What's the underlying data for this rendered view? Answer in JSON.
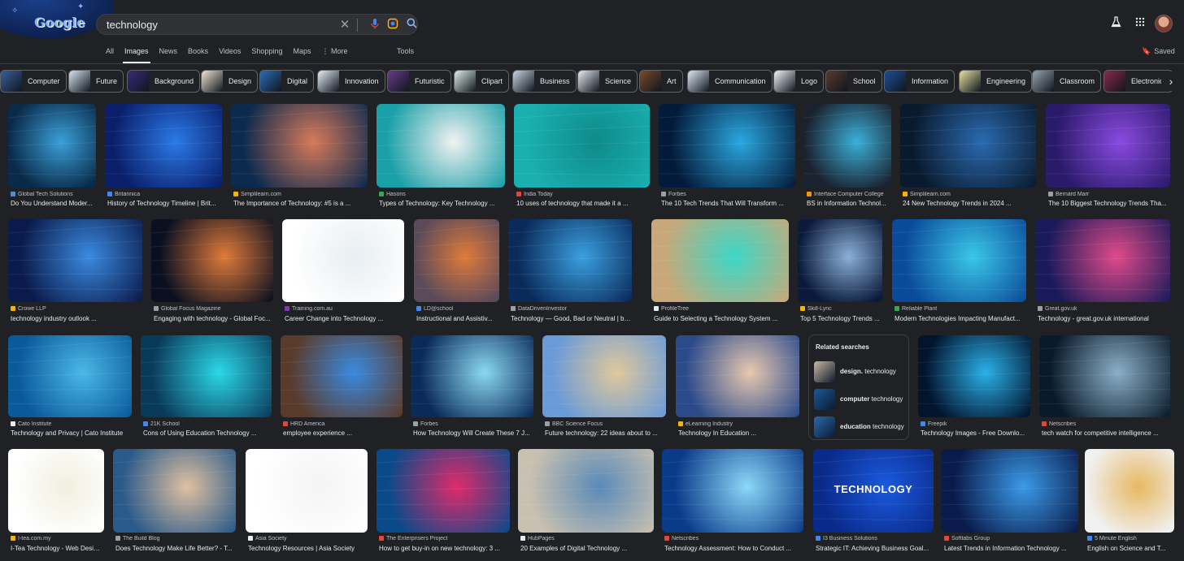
{
  "header": {
    "logo_text": "Google",
    "search_query": "technology",
    "clear_icon": "close-icon",
    "mic_icon": "microphone-icon",
    "lens_icon": "camera-lens-icon",
    "search_icon": "search-icon",
    "labs_icon": "flask-icon",
    "apps_icon": "apps-grid-icon"
  },
  "tabs": [
    "All",
    "Images",
    "News",
    "Books",
    "Videos",
    "Shopping",
    "Maps",
    "More"
  ],
  "active_tab": "Images",
  "tools_label": "Tools",
  "saved_label": "Saved",
  "chips": [
    {
      "label": "Computer",
      "color": "#3a5f9e"
    },
    {
      "label": "Future",
      "color": "#d8e6f2"
    },
    {
      "label": "Background",
      "color": "#3b2a7a"
    },
    {
      "label": "Design",
      "color": "#f0e6d0"
    },
    {
      "label": "Digital",
      "color": "#2a6db8"
    },
    {
      "label": "Innovation",
      "color": "#e8eef6"
    },
    {
      "label": "Futuristic",
      "color": "#6a3a8a"
    },
    {
      "label": "Clipart",
      "color": "#e0efe8"
    },
    {
      "label": "Business",
      "color": "#c9d4e0"
    },
    {
      "label": "Science",
      "color": "#e6ecef"
    },
    {
      "label": "Art",
      "color": "#7a4a2a"
    },
    {
      "label": "Communication",
      "color": "#dfe9f6"
    },
    {
      "label": "Logo",
      "color": "#f2f4f7"
    },
    {
      "label": "School",
      "color": "#5a3a2a"
    },
    {
      "label": "Information",
      "color": "#1f4e96"
    },
    {
      "label": "Engineering",
      "color": "#e8e2a0"
    },
    {
      "label": "Classroom",
      "color": "#9aa4ae"
    },
    {
      "label": "Electronics",
      "color": "#8a2a4a"
    }
  ],
  "results": [
    {
      "source": "Global Tech Solutions",
      "title": "Do You Understand Moder...",
      "fav": "#4a90d9",
      "c1": "#0a2a4a",
      "c2": "#3aa0d8"
    },
    {
      "source": "Britannica",
      "title": "History of Technology Timeline | Brit...",
      "fav": "#4285f4",
      "c1": "#0a1e6a",
      "c2": "#2a7ae8"
    },
    {
      "source": "Simplilearn.com",
      "title": "The Importance of Technology: #5 is a ...",
      "fav": "#f4b400",
      "c1": "#0c2a4e",
      "c2": "#d87a5a"
    },
    {
      "source": "Hasons",
      "title": "Types of Technology: Key Technology ...",
      "fav": "#34a853",
      "c1": "#1aa0a8",
      "c2": "#f2f2f2"
    },
    {
      "source": "India Today",
      "title": "10 uses of technology that made it a ...",
      "fav": "#ea4335",
      "c1": "#1ab0b0",
      "c2": "#0e8a8a"
    },
    {
      "source": "Forbes",
      "title": "The 10 Tech Trends That Will Transform ...",
      "fav": "#9aa0a6",
      "c1": "#041a3a",
      "c2": "#2aa8e0"
    },
    {
      "source": "Interface Computer College",
      "title": "BS in Information Technol...",
      "fav": "#f29900",
      "c1": "#1a2230",
      "c2": "#3ab0d8"
    },
    {
      "source": "Simplilearn.com",
      "title": "24 New Technology Trends in 2024 ...",
      "fav": "#f4b400",
      "c1": "#0a1a2e",
      "c2": "#2a6ab0"
    },
    {
      "source": "Bernard Marr",
      "title": "The 10 Biggest Technology Trends Tha...",
      "fav": "#9aa0a6",
      "c1": "#2a1a6a",
      "c2": "#8a4ae0"
    },
    {
      "source": "Crowe LLP",
      "title": "technology industry outlook ...",
      "fav": "#f4b400",
      "c1": "#0a1a4a",
      "c2": "#3a8ae0"
    },
    {
      "source": "Global Focus Magazine",
      "title": "Engaging with technology - Global Foc...",
      "fav": "#9aa0a6",
      "c1": "#0a1020",
      "c2": "#e07a3a"
    },
    {
      "source": "Training.com.au",
      "title": "Career Change into Technology ...",
      "fav": "#7a3ab0",
      "c1": "#ffffff",
      "c2": "#e8eef2"
    },
    {
      "source": "LD@school",
      "title": "Instructional and Assistiv...",
      "fav": "#4285f4",
      "c1": "#5a4a5a",
      "c2": "#e07a3a"
    },
    {
      "source": "DataDrivenInvestor",
      "title": "Technology — Good, Bad or Neutral | by ...",
      "fav": "#9aa0a6",
      "c1": "#0a2a5a",
      "c2": "#3aa0e0"
    },
    {
      "source": "ProfileTree",
      "title": "Guide to Selecting a Technology System ...",
      "fav": "#e8eaed",
      "c1": "#c8a878",
      "c2": "#3ad8c8"
    },
    {
      "source": "Skill-Lync",
      "title": "Top 5 Technology Trends ...",
      "fav": "#f4b400",
      "c1": "#0a1a3a",
      "c2": "#8ab0d8"
    },
    {
      "source": "Reliable Plant",
      "title": "Modern Technologies Impacting Manufact...",
      "fav": "#34a853",
      "c1": "#0a4a9a",
      "c2": "#3ac8e8"
    },
    {
      "source": "Great.gov.uk",
      "title": "Technology - great.gov.uk international",
      "fav": "#9aa0a6",
      "c1": "#1a1a5a",
      "c2": "#e04a8a"
    },
    {
      "source": "Cato Institute",
      "title": "Technology and Privacy | Cato Institute",
      "fav": "#e8eaed",
      "c1": "#0a5a9a",
      "c2": "#4ab8e8"
    },
    {
      "source": "21K School",
      "title": "Cons of Using Education Technology ...",
      "fav": "#4285f4",
      "c1": "#0a3a5a",
      "c2": "#2ad8e8"
    },
    {
      "source": "HRD America",
      "title": "employee experience ...",
      "fav": "#ea4335",
      "c1": "#5a3a2a",
      "c2": "#3a8ae0"
    },
    {
      "source": "Forbes",
      "title": "How Technology Will Create These 7 J...",
      "fav": "#9aa0a6",
      "c1": "#0a2a5a",
      "c2": "#8ad8f0"
    },
    {
      "source": "BBC Science Focus",
      "title": "Future technology: 22 ideas about to ...",
      "fav": "#9aa0a6",
      "c1": "#6a9ad8",
      "c2": "#e0c89a"
    },
    {
      "source": "eLearning Industry",
      "title": "Technology In Education ...",
      "fav": "#f4b400",
      "c1": "#2a4a8a",
      "c2": "#e8c8b0"
    },
    {
      "source": "Freepik",
      "title": "Technology Images - Free Downlo...",
      "fav": "#4285f4",
      "c1": "#02142e",
      "c2": "#2ab0e8"
    },
    {
      "source": "Netscribes",
      "title": "tech watch for competitive intelligence ...",
      "fav": "#ea4335",
      "c1": "#0a1a2a",
      "c2": "#8ab0c8"
    },
    {
      "source": "I-tea.com.my",
      "title": "I-Tea Technology - Web Design ...",
      "fav": "#f4b400",
      "c1": "#ffffff",
      "c2": "#f0f0e0"
    },
    {
      "source": "The Build Blog",
      "title": "Does Technology Make Life Better? - T...",
      "fav": "#9aa0a6",
      "c1": "#2a5a8a",
      "c2": "#e0c0a0"
    },
    {
      "source": "Asia Society",
      "title": "Technology Resources | Asia Society",
      "fav": "#e8eaed",
      "c1": "#ffffff",
      "c2": "#f4f4f4"
    },
    {
      "source": "The Enterprisers Project",
      "title": "How to get buy-in on new technology: 3 ...",
      "fav": "#ea4335",
      "c1": "#0a4a8a",
      "c2": "#e02a6a"
    },
    {
      "source": "HubPages",
      "title": "20 Examples of Digital Technology ...",
      "fav": "#e8eaed",
      "c1": "#c8c0b0",
      "c2": "#5a8ab8"
    },
    {
      "source": "Netscribes",
      "title": "Technology Assessment: How to Conduct ...",
      "fav": "#ea4335",
      "c1": "#0a3a8a",
      "c2": "#8ad8f8"
    },
    {
      "source": "I3 Business Solutions",
      "title": "Strategic IT: Achieving Business Goal...",
      "fav": "#4285f4",
      "c1": "#0a2a8a",
      "c2": "#1a5ae0"
    },
    {
      "source": "Softtabs Group",
      "title": "Latest Trends in Information Technology ...",
      "fav": "#ea4335",
      "c1": "#0a1a4a",
      "c2": "#3a9ae8"
    },
    {
      "source": "5 Minute English",
      "title": "English on Science and T...",
      "fav": "#4285f4",
      "c1": "#f0f0f0",
      "c2": "#e8b860"
    }
  ],
  "related": {
    "heading": "Related searches",
    "items": [
      {
        "bold": "design.",
        "rest": " technology",
        "color": "#c8b8a0"
      },
      {
        "bold": "computer",
        "rest": " technology",
        "color": "#1a5a9a"
      },
      {
        "bold": "education",
        "rest": " technology",
        "color": "#2a6ab0"
      }
    ]
  },
  "image_overlays": {
    "tech_card_text": "TECHNOLOGY"
  }
}
